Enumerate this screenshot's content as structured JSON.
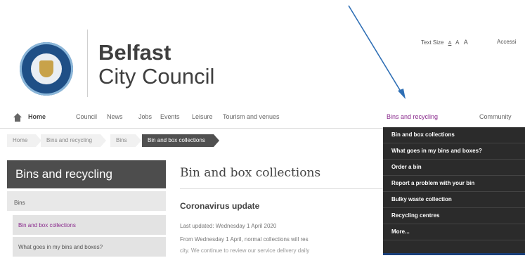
{
  "brand": {
    "line1": "Belfast",
    "line2": "City Council"
  },
  "header": {
    "text_size_label": "Text Size",
    "text_size_small": "A",
    "text_size_medium": "A",
    "text_size_large": "A",
    "accessibility_label": "Accessi"
  },
  "nav": {
    "home": "Home",
    "items": [
      "Council",
      "News",
      "Jobs",
      "Events",
      "Leisure",
      "Tourism and venues",
      "Bins and recycling",
      "Community"
    ]
  },
  "breadcrumb": [
    "Home",
    "Bins and recycling",
    "Bins",
    "Bin and box collections"
  ],
  "sidebar": {
    "title": "Bins and recycling",
    "section": "Bins",
    "items": [
      "Bin and box collections",
      "What goes in my bins and boxes?"
    ]
  },
  "main": {
    "title": "Bin and box collections",
    "subtitle": "Coronavirus update",
    "updated": "Last updated: Wednesday 1 April 2020",
    "body1": "From Wednesday 1 April, normal collections will res",
    "body2": "city. We continue to review our service delivery daily"
  },
  "dropdown": [
    "Bin and box collections",
    "What goes in my bins and boxes?",
    "Order a bin",
    "Report a problem with your bin",
    "Bulky waste collection",
    "Recycling centres",
    "More..."
  ],
  "colors": {
    "accent": "#8a2b8d",
    "dark": "#2b2b2b",
    "arrow": "#2f6fb5"
  }
}
